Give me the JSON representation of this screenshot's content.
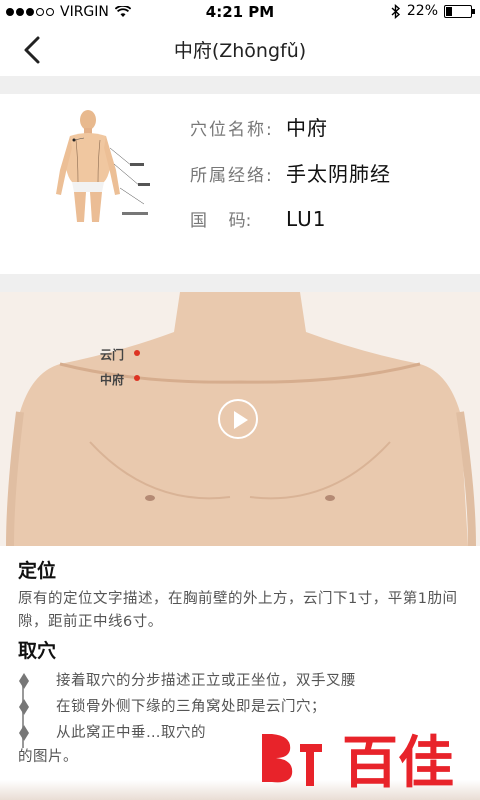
{
  "status_bar": {
    "carrier": "VIRGIN",
    "time": "4:21 PM",
    "battery": "22%",
    "battery_level": 0.22
  },
  "nav": {
    "title": "中府(Zhōngfǔ)"
  },
  "info": {
    "name_label": "穴位名称:",
    "name_value": "中府",
    "meridian_label": "所属经络:",
    "meridian_value": "手太阴肺经",
    "code_label": "国    码:",
    "code_value": "LU1"
  },
  "photo": {
    "point_yunmen": "云门",
    "point_zhongfu": "中府"
  },
  "location": {
    "heading": "定位",
    "text": "原有的定位文字描述，在胸前壁的外上方，云门下1寸，平第1肋间隙，距前正中线6寸。"
  },
  "method": {
    "heading": "取穴",
    "steps": [
      "接着取穴的分步描述正立或正坐位，双手叉腰",
      "在锁骨外侧下缘的三角窝处即是云门穴；",
      "从此窝正中垂…取穴的",
      "的图片。"
    ]
  },
  "watermark": {
    "text": "百佳"
  },
  "colors": {
    "separator": "#efefef",
    "icon_gray": "#aaaaaa",
    "watermark_red": "#e8232a",
    "point_red": "#dd3322"
  }
}
